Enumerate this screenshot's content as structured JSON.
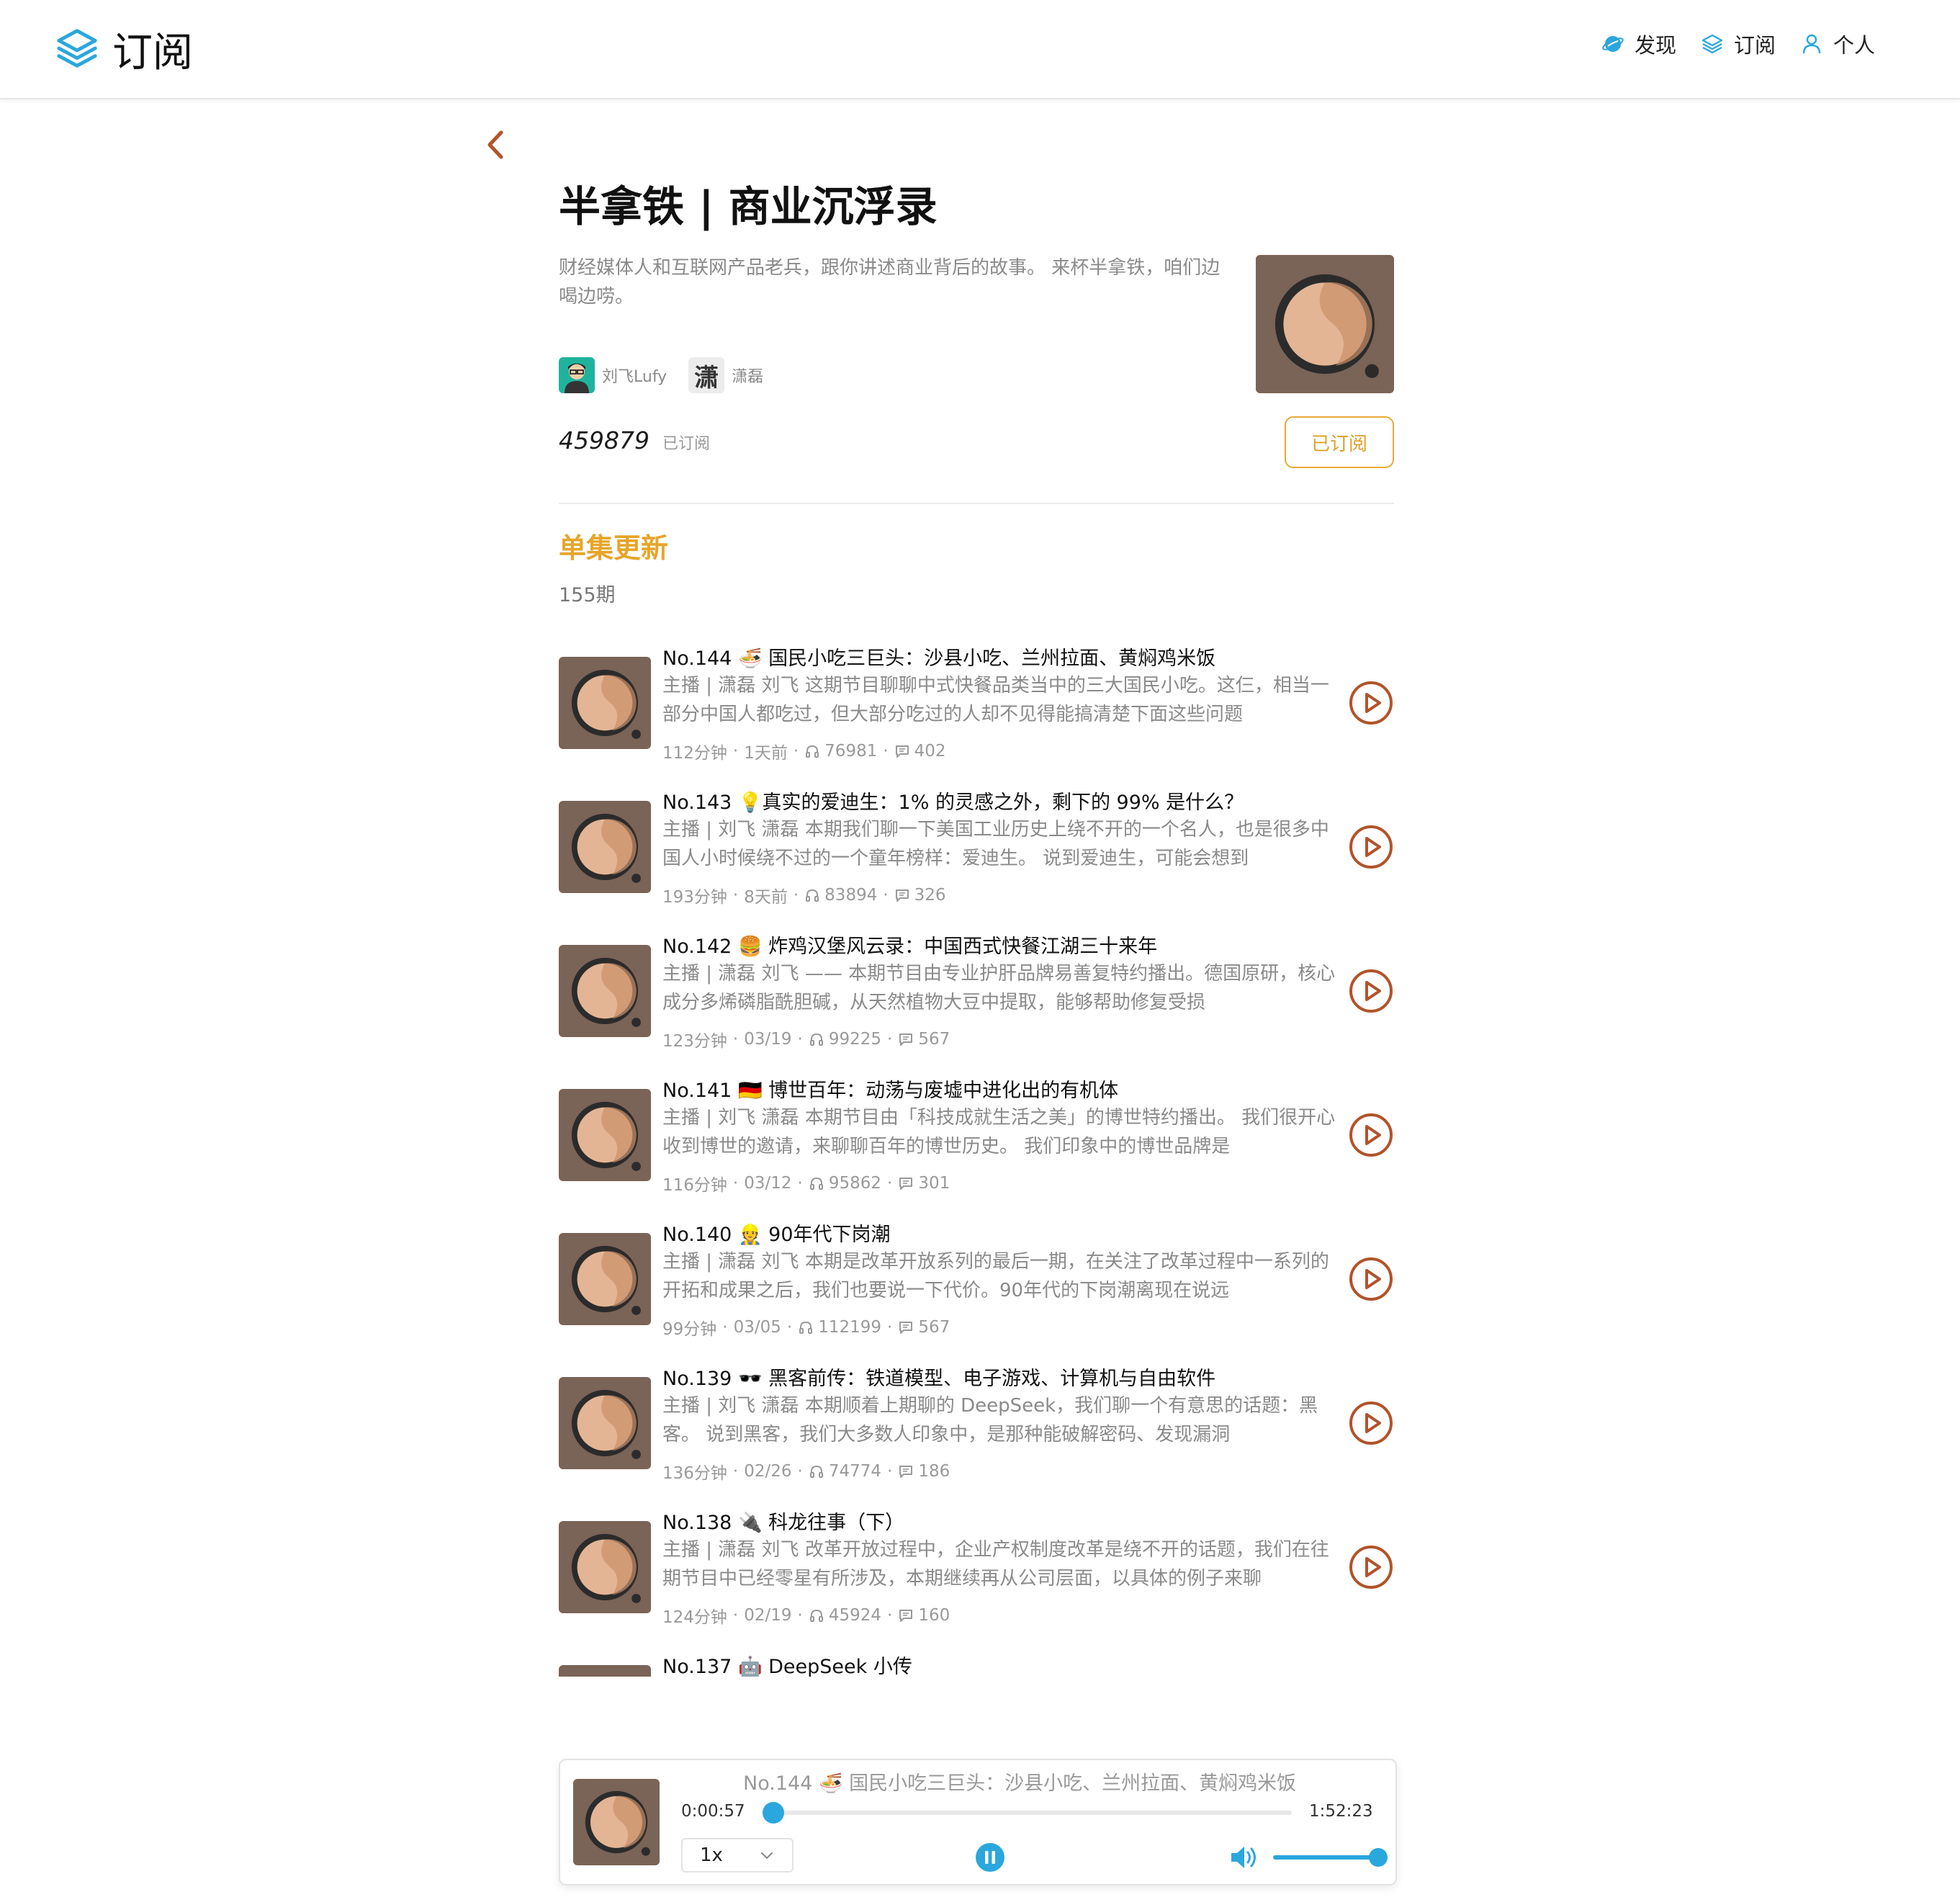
{
  "app": {
    "title": "订阅"
  },
  "nav": [
    {
      "label": "发现",
      "icon": "planet-icon"
    },
    {
      "label": "订阅",
      "icon": "layers-icon"
    },
    {
      "label": "个人",
      "icon": "user-icon"
    }
  ],
  "podcast": {
    "title": "半拿铁 | 商业沉浮录",
    "description": "财经媒体人和互联网产品老兵，跟你讲述商业背后的故事。 来杯半拿铁，咱们边喝边唠。",
    "hosts": [
      {
        "name": "刘飞Lufy",
        "avatar": "host-avatar-liufei"
      },
      {
        "name": "潇磊",
        "avatar": "host-avatar-xiaolei",
        "glyph": "潇"
      }
    ],
    "subscriber_count": "459879",
    "subscribed_text": "已订阅",
    "subscribe_button": "已订阅"
  },
  "episodes_section": {
    "title": "单集更新",
    "count": "155期"
  },
  "episodes": [
    {
      "title": "No.144 🍜 国民小吃三巨头：沙县小吃、兰州拉面、黄焖鸡米饭",
      "desc": "主播 | 潇磊 刘飞 这期节目聊聊中式快餐品类当中的三大国民小吃。这仨，相当一部分中国人都吃过，但大部分吃过的人却不见得能搞清楚下面这些问题",
      "duration": "112分钟",
      "date": "1天前",
      "plays": "76981",
      "comments": "402"
    },
    {
      "title": "No.143 💡真实的爱迪生：1% 的灵感之外，剩下的 99% 是什么？",
      "desc": "主播 | 刘飞 潇磊 本期我们聊一下美国工业历史上绕不开的一个名人，也是很多中国人小时候绕不过的一个童年榜样：爱迪生。 说到爱迪生，可能会想到",
      "duration": "193分钟",
      "date": "8天前",
      "plays": "83894",
      "comments": "326"
    },
    {
      "title": "No.142 🍔 炸鸡汉堡风云录：中国西式快餐江湖三十来年",
      "desc": "主播 | 潇磊 刘飞 —— 本期节目由专业护肝品牌易善复特约播出。德国原研，核心成分多烯磷脂酰胆碱，从天然植物大豆中提取，能够帮助修复受损",
      "duration": "123分钟",
      "date": "03/19",
      "plays": "99225",
      "comments": "567"
    },
    {
      "title": "No.141 🇩🇪 博世百年：动荡与废墟中进化出的有机体",
      "desc": "主播 | 刘飞 潇磊 本期节目由「科技成就生活之美」的博世特约播出。 我们很开心收到博世的邀请，来聊聊百年的博世历史。 我们印象中的博世品牌是",
      "duration": "116分钟",
      "date": "03/12",
      "plays": "95862",
      "comments": "301"
    },
    {
      "title": "No.140 👷 90年代下岗潮",
      "desc": "主播 | 潇磊 刘飞 本期是改革开放系列的最后一期，在关注了改革过程中一系列的开拓和成果之后，我们也要说一下代价。90年代的下岗潮离现在说远",
      "duration": "99分钟",
      "date": "03/05",
      "plays": "112199",
      "comments": "567"
    },
    {
      "title": "No.139 🕶️ 黑客前传：铁道模型、电子游戏、计算机与自由软件",
      "desc": "主播 | 刘飞 潇磊 本期顺着上期聊的 DeepSeek，我们聊一个有意思的话题：黑客。 说到黑客，我们大多数人印象中，是那种能破解密码、发现漏洞",
      "duration": "136分钟",
      "date": "02/26",
      "plays": "74774",
      "comments": "186"
    },
    {
      "title": "No.138 🔌 科龙往事（下）",
      "desc": "主播 | 潇磊 刘飞 改革开放过程中，企业产权制度改革是绕不开的话题，我们在往期节目中已经零星有所涉及，本期继续再从公司层面，以具体的例子来聊",
      "duration": "124分钟",
      "date": "02/19",
      "plays": "45924",
      "comments": "160"
    },
    {
      "title": "No.137 🤖 DeepSeek 小传",
      "desc": "",
      "duration": "",
      "date": "",
      "plays": "",
      "comments": ""
    }
  ],
  "player": {
    "title": "No.144 🍜 国民小吃三巨头：沙县小吃、兰州拉面、黄焖鸡米饭",
    "current_time": "0:00:57",
    "total_time": "1:52:23",
    "progress": 0.0085,
    "speed": "1x",
    "volume": 1.0
  },
  "colors": {
    "accent_blue": "#2aa7dd",
    "accent_orange": "#e6a52a",
    "play_brown": "#b0542a",
    "cover_bg": "#7a6357",
    "cover_disc": "#e3b595"
  }
}
